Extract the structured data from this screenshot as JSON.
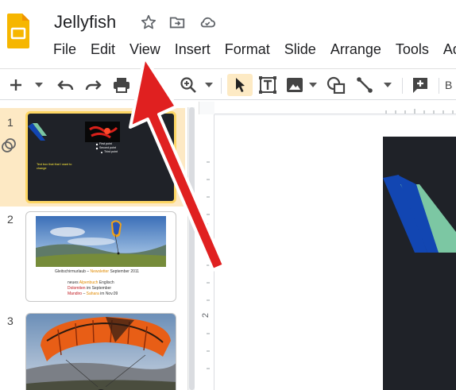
{
  "header": {
    "title": "Jellyfish",
    "menus": [
      "File",
      "Edit",
      "View",
      "Insert",
      "Format",
      "Slide",
      "Arrange",
      "Tools",
      "Ad"
    ]
  },
  "toolbar": {
    "font_partial": "B"
  },
  "slides": [
    {
      "number": "1",
      "bullets": [
        "First point",
        "Second point",
        "Third point"
      ],
      "caption": "Text box that that I want to change"
    },
    {
      "number": "2",
      "line1_a": "Gleitschirmurlaub – ",
      "line1_b": "Newsletter",
      "line1_c": " September 2011",
      "line2_a": "neues ",
      "line2_b": "Alpenbuch",
      "line2_c": " Englisch",
      "line3_a": "Dolomiten",
      "line3_b": " im September",
      "line4_a": "Mandiro",
      "line4_b": " – ",
      "line4_c": "Sahara",
      "line4_d": " im Nov.09"
    },
    {
      "number": "3"
    }
  ],
  "ruler": {
    "v1": "1",
    "v2": "2"
  },
  "colors": {
    "accent_selected": "#fdd663",
    "slide_bg": "#1f2228",
    "slide_blue": "#1246b2",
    "slide_teal": "#7cc7a3",
    "arrow_red": "#e02020",
    "logo_yellow": "#f6b600"
  }
}
